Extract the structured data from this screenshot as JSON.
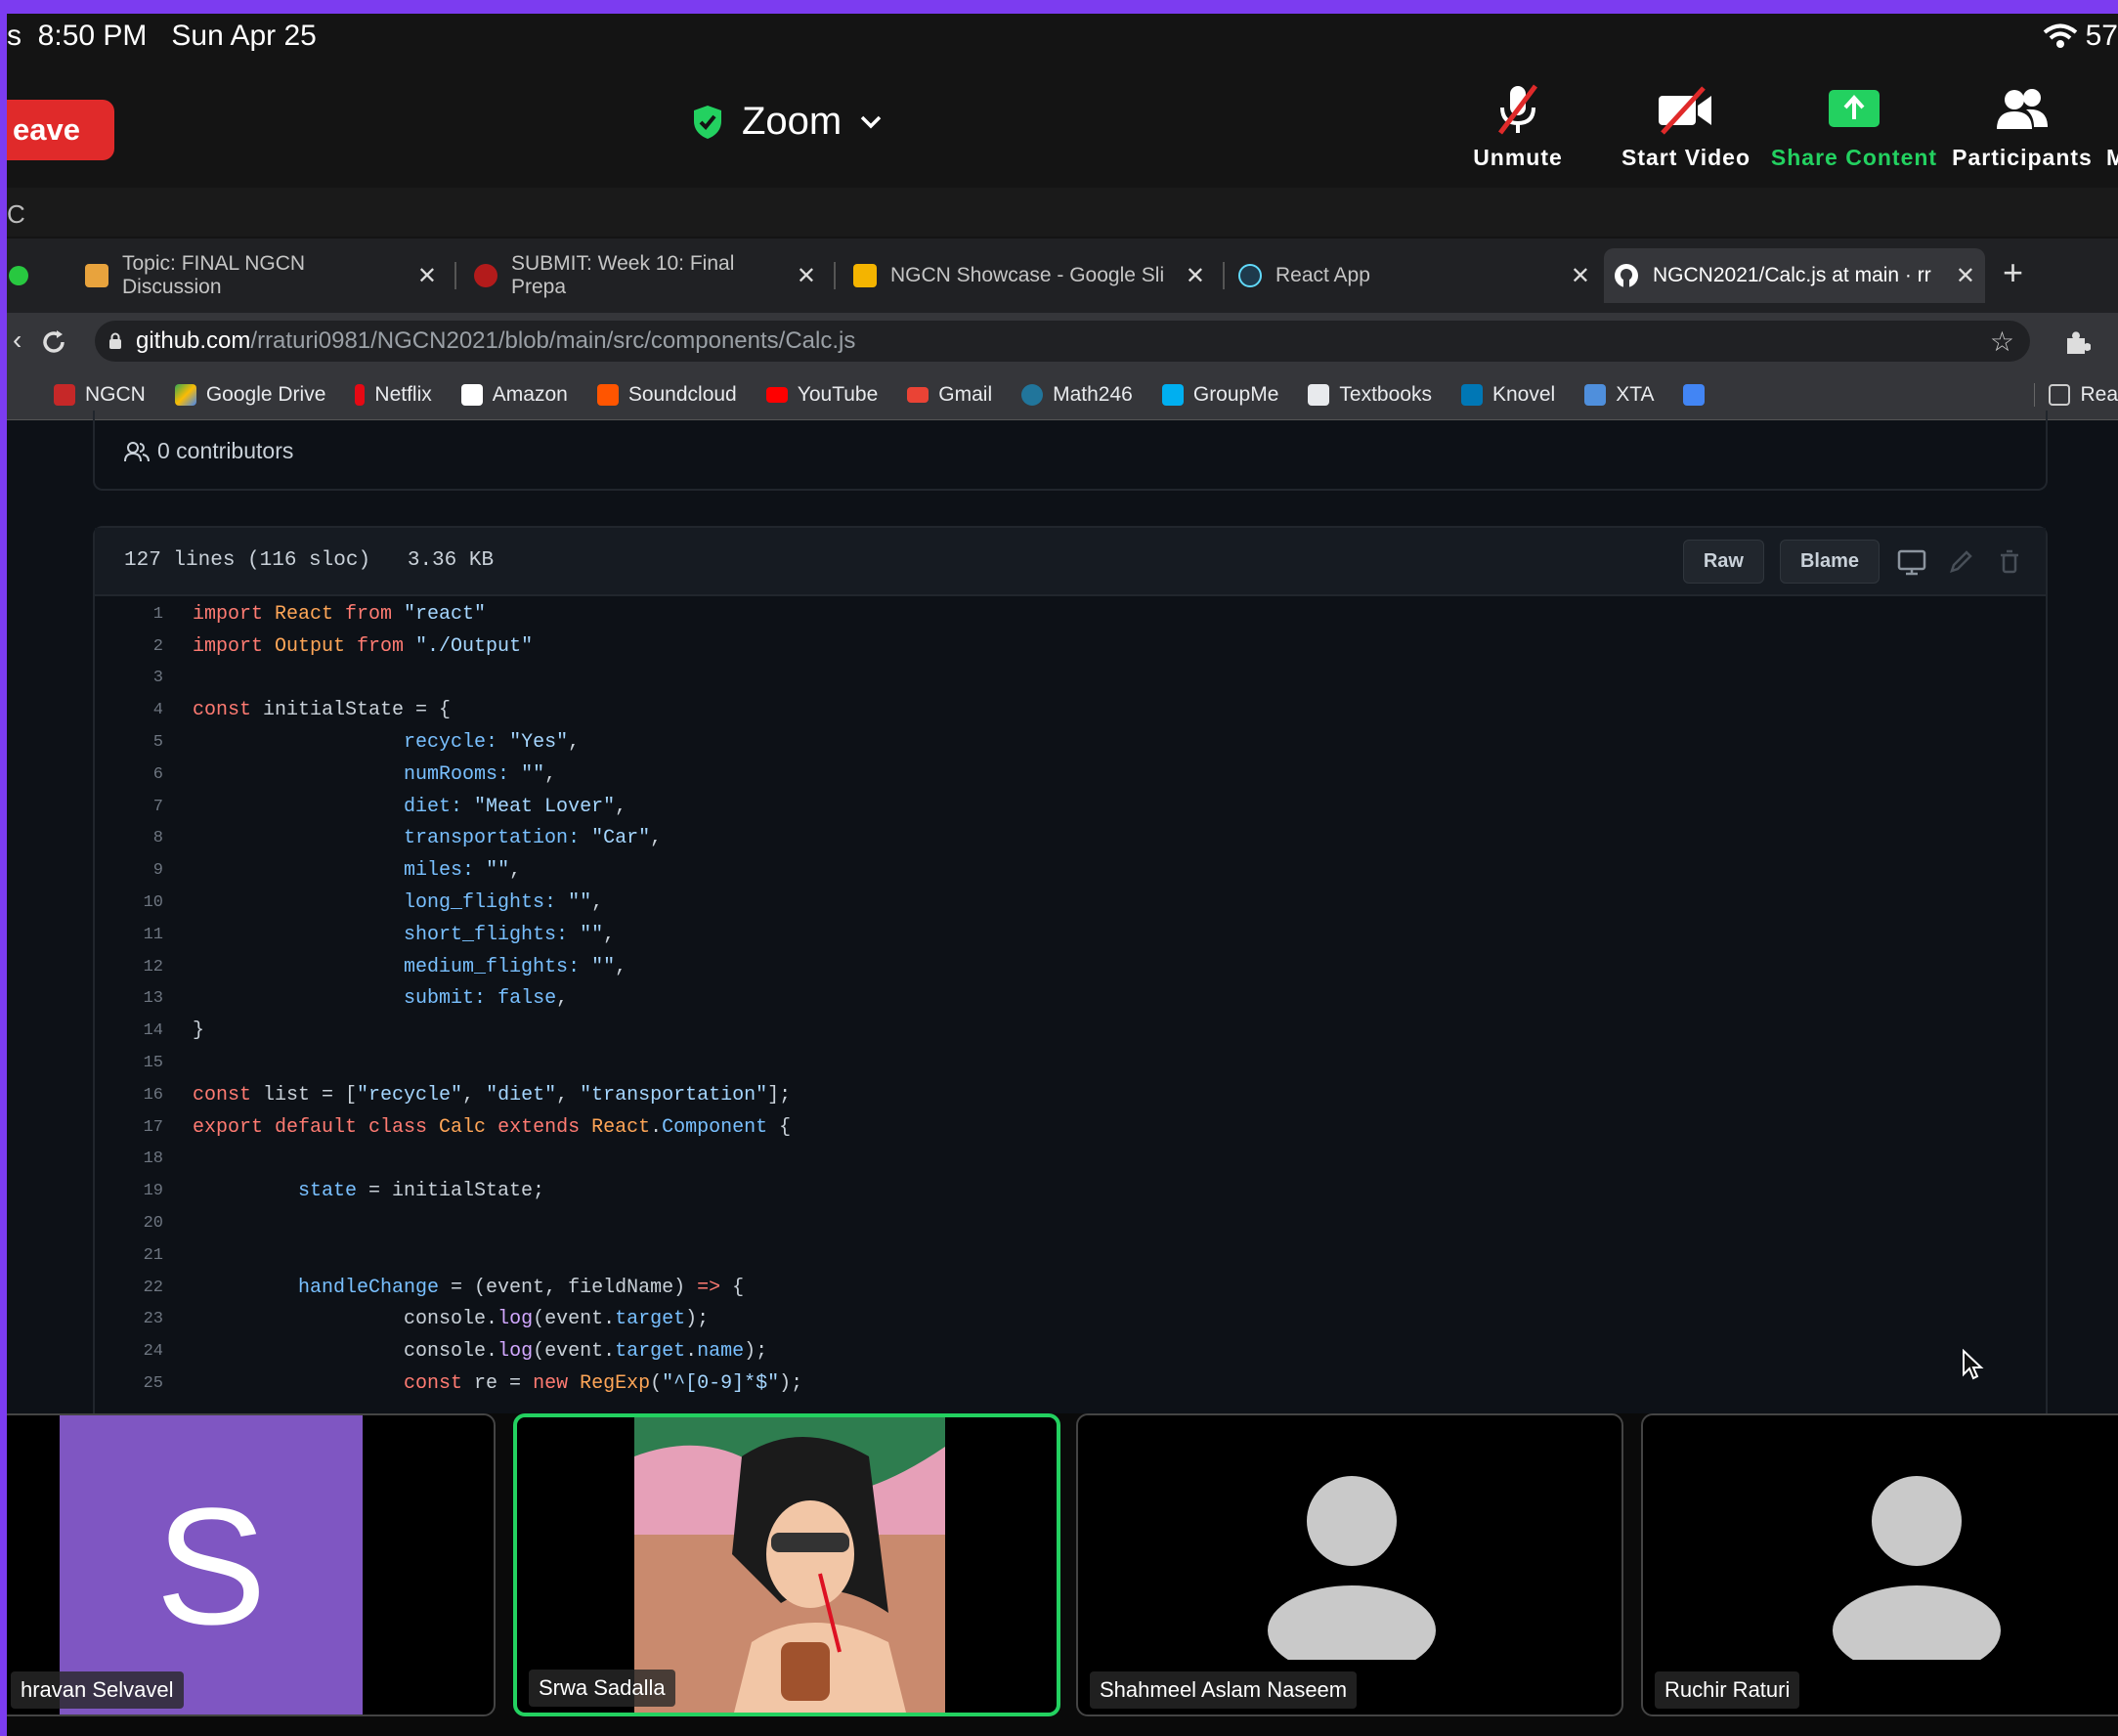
{
  "statusbar": {
    "time": "8:50 PM",
    "date": "Sun Apr 25",
    "left_fragment": "s",
    "battery_fragment": "57"
  },
  "zoom": {
    "leave_label": "eave",
    "title": "Zoom",
    "toolbar": [
      {
        "label": "Unmute",
        "icon": "muted-mic-icon"
      },
      {
        "label": "Start Video",
        "icon": "video-off-icon"
      },
      {
        "label": "Share Content",
        "icon": "share-screen-icon"
      },
      {
        "label": "Participants",
        "icon": "participants-icon"
      }
    ],
    "more_fragment": "M"
  },
  "thin_bar": {
    "text": "C"
  },
  "browser": {
    "tabs": [
      {
        "title": "Topic: FINAL NGCN Discussion",
        "color": "#e8a33d"
      },
      {
        "title": "SUBMIT: Week 10: Final Prepa",
        "color": "#b31b1b"
      },
      {
        "title": "NGCN Showcase - Google Sli",
        "color": "#f4b400"
      },
      {
        "title": "React App",
        "color": "#61dafb"
      },
      {
        "title": "NGCN2021/Calc.js at main · rr",
        "color": "#ffffff"
      }
    ],
    "url_domain": "github.com",
    "url_path": "/rraturi0981/NGCN2021/blob/main/src/components/Calc.js",
    "bookmarks": [
      {
        "label": "NGCN",
        "color": "#c62828"
      },
      {
        "label": "Google Drive",
        "color": "#34a853"
      },
      {
        "label": "Netflix",
        "color": "#e50914"
      },
      {
        "label": "Amazon",
        "color": "#ffffff"
      },
      {
        "label": "Soundcloud",
        "color": "#ff5500"
      },
      {
        "label": "YouTube",
        "color": "#ff0000"
      },
      {
        "label": "Gmail",
        "color": "#ea4335"
      },
      {
        "label": "Math246",
        "color": "#21759b"
      },
      {
        "label": "GroupMe",
        "color": "#00aff0"
      },
      {
        "label": "Textbooks",
        "color": "#e8eaed"
      },
      {
        "label": "Knovel",
        "color": "#0077b5"
      },
      {
        "label": "XTA",
        "color": "#4f8fdc"
      }
    ],
    "reading_list_fragment": "Rea"
  },
  "github": {
    "contributors": "0 contributors",
    "file_info": "127 lines (116 sloc)   3.36 KB",
    "raw_label": "Raw",
    "blame_label": "Blame",
    "code_lines": [
      [
        [
          "import ",
          "#ff7b72"
        ],
        [
          "React ",
          "#ffa657"
        ],
        [
          "from ",
          "#ff7b72"
        ],
        [
          "\"react\"",
          "#a5d6ff"
        ]
      ],
      [
        [
          "import ",
          "#ff7b72"
        ],
        [
          "Output ",
          "#ffa657"
        ],
        [
          "from ",
          "#ff7b72"
        ],
        [
          "\"./Output\"",
          "#a5d6ff"
        ]
      ],
      [],
      [
        [
          "const ",
          "#ff7b72"
        ],
        [
          "initialState = {",
          "#c9d1d9"
        ]
      ],
      [
        [
          "                  recycle: ",
          "#79c0ff"
        ],
        [
          "\"Yes\"",
          "#a5d6ff"
        ],
        [
          ",",
          "#c9d1d9"
        ]
      ],
      [
        [
          "                  numRooms: ",
          "#79c0ff"
        ],
        [
          "\"\"",
          "#a5d6ff"
        ],
        [
          ",",
          "#c9d1d9"
        ]
      ],
      [
        [
          "                  diet: ",
          "#79c0ff"
        ],
        [
          "\"Meat Lover\"",
          "#a5d6ff"
        ],
        [
          ",",
          "#c9d1d9"
        ]
      ],
      [
        [
          "                  transportation: ",
          "#79c0ff"
        ],
        [
          "\"Car\"",
          "#a5d6ff"
        ],
        [
          ",",
          "#c9d1d9"
        ]
      ],
      [
        [
          "                  miles: ",
          "#79c0ff"
        ],
        [
          "\"\"",
          "#a5d6ff"
        ],
        [
          ",",
          "#c9d1d9"
        ]
      ],
      [
        [
          "                  long_flights: ",
          "#79c0ff"
        ],
        [
          "\"\"",
          "#a5d6ff"
        ],
        [
          ",",
          "#c9d1d9"
        ]
      ],
      [
        [
          "                  short_flights: ",
          "#79c0ff"
        ],
        [
          "\"\"",
          "#a5d6ff"
        ],
        [
          ",",
          "#c9d1d9"
        ]
      ],
      [
        [
          "                  medium_flights: ",
          "#79c0ff"
        ],
        [
          "\"\"",
          "#a5d6ff"
        ],
        [
          ",",
          "#c9d1d9"
        ]
      ],
      [
        [
          "                  submit: ",
          "#79c0ff"
        ],
        [
          "false",
          "#79c0ff"
        ],
        [
          ",",
          "#c9d1d9"
        ]
      ],
      [
        [
          "}",
          "#c9d1d9"
        ]
      ],
      [],
      [
        [
          "const ",
          "#ff7b72"
        ],
        [
          "list = [",
          "#c9d1d9"
        ],
        [
          "\"recycle\"",
          "#a5d6ff"
        ],
        [
          ", ",
          "#c9d1d9"
        ],
        [
          "\"diet\"",
          "#a5d6ff"
        ],
        [
          ", ",
          "#c9d1d9"
        ],
        [
          "\"transportation\"",
          "#a5d6ff"
        ],
        [
          "];",
          "#c9d1d9"
        ]
      ],
      [
        [
          "export default class ",
          "#ff7b72"
        ],
        [
          "Calc ",
          "#ffa657"
        ],
        [
          "extends ",
          "#ff7b72"
        ],
        [
          "React",
          "#ffa657"
        ],
        [
          ".",
          "#c9d1d9"
        ],
        [
          "Component ",
          "#79c0ff"
        ],
        [
          "{",
          "#c9d1d9"
        ]
      ],
      [],
      [
        [
          "         state ",
          "#79c0ff"
        ],
        [
          "= initialState;",
          "#c9d1d9"
        ]
      ],
      [],
      [],
      [
        [
          "         handleChange ",
          "#79c0ff"
        ],
        [
          "= (event, fieldName) ",
          "#c9d1d9"
        ],
        [
          "=> ",
          "#ff7b72"
        ],
        [
          "{",
          "#c9d1d9"
        ]
      ],
      [
        [
          "                  console.",
          "#c9d1d9"
        ],
        [
          "log",
          "#d2a8ff"
        ],
        [
          "(event.",
          "#c9d1d9"
        ],
        [
          "target",
          "#79c0ff"
        ],
        [
          ");",
          "#c9d1d9"
        ]
      ],
      [
        [
          "                  console.",
          "#c9d1d9"
        ],
        [
          "log",
          "#d2a8ff"
        ],
        [
          "(event.",
          "#c9d1d9"
        ],
        [
          "target",
          "#79c0ff"
        ],
        [
          ".",
          "#c9d1d9"
        ],
        [
          "name",
          "#79c0ff"
        ],
        [
          ");",
          "#c9d1d9"
        ]
      ],
      [
        [
          "                  const ",
          "#ff7b72"
        ],
        [
          "re = ",
          "#c9d1d9"
        ],
        [
          "new ",
          "#ff7b72"
        ],
        [
          "RegExp",
          "#ffa657"
        ],
        [
          "(",
          "#c9d1d9"
        ],
        [
          "\"^[0-9]*$\"",
          "#a5d6ff"
        ],
        [
          ");",
          "#c9d1d9"
        ]
      ]
    ]
  },
  "participants": [
    {
      "name": "hravan Selvavel",
      "initial": "S"
    },
    {
      "name": "Srwa Sadalla"
    },
    {
      "name": "Shahmeel Aslam Naseem"
    },
    {
      "name": "Ruchir Raturi"
    }
  ]
}
